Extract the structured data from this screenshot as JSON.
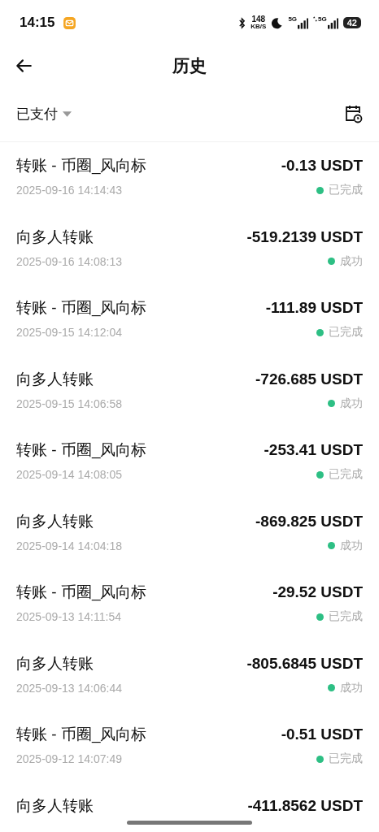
{
  "status_bar": {
    "time": "14:15",
    "speed": "148",
    "speed_unit": "KB/S",
    "sim1": "5G",
    "sim2": "5G",
    "battery": "42"
  },
  "header": {
    "title": "历史"
  },
  "filter": {
    "label": "已支付"
  },
  "transactions": [
    {
      "title": "转账 - 币圈_风向标",
      "time": "2025-09-16 14:14:43",
      "amount": "-0.13 USDT",
      "status": "已完成"
    },
    {
      "title": "向多人转账",
      "time": "2025-09-16 14:08:13",
      "amount": "-519.2139 USDT",
      "status": "成功"
    },
    {
      "title": "转账 - 币圈_风向标",
      "time": "2025-09-15 14:12:04",
      "amount": "-111.89 USDT",
      "status": "已完成"
    },
    {
      "title": "向多人转账",
      "time": "2025-09-15 14:06:58",
      "amount": "-726.685 USDT",
      "status": "成功"
    },
    {
      "title": "转账 - 币圈_风向标",
      "time": "2025-09-14 14:08:05",
      "amount": "-253.41 USDT",
      "status": "已完成"
    },
    {
      "title": "向多人转账",
      "time": "2025-09-14 14:04:18",
      "amount": "-869.825 USDT",
      "status": "成功"
    },
    {
      "title": "转账 - 币圈_风向标",
      "time": "2025-09-13 14:11:54",
      "amount": "-29.52 USDT",
      "status": "已完成"
    },
    {
      "title": "向多人转账",
      "time": "2025-09-13 14:06:44",
      "amount": "-805.6845 USDT",
      "status": "成功"
    },
    {
      "title": "转账 - 币圈_风向标",
      "time": "2025-09-12 14:07:49",
      "amount": "-0.51 USDT",
      "status": "已完成"
    },
    {
      "title": "向多人转账",
      "amount": "-411.8562 USDT"
    }
  ]
}
